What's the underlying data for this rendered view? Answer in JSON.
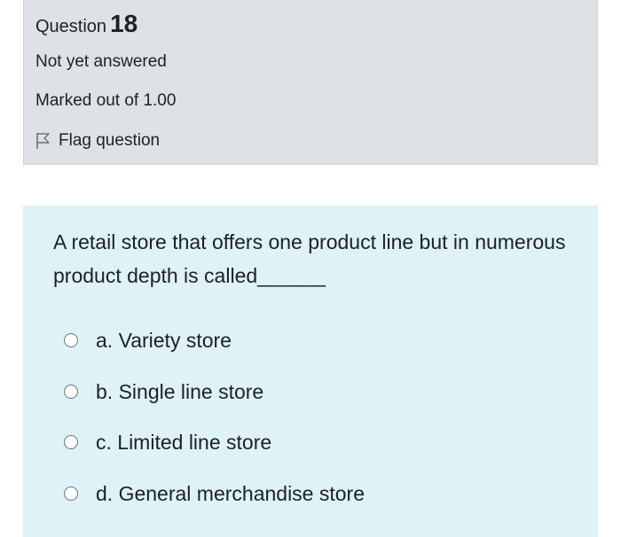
{
  "question_info": {
    "label": "Question",
    "number": "18",
    "status": "Not yet answered",
    "marks": "Marked out of 1.00",
    "flag_label": "Flag question"
  },
  "question": {
    "text": "A retail store that offers one product line but in numerous product depth is called______",
    "answers": [
      {
        "label": "a. Variety store"
      },
      {
        "label": "b. Single line store"
      },
      {
        "label": "c. Limited line store"
      },
      {
        "label": "d. General merchandise store"
      }
    ]
  },
  "colors": {
    "info_background": "#dee2e6",
    "content_background": "#def2f8",
    "text": "#1d2125"
  },
  "icons": {
    "flag": "flag-outline-icon",
    "radio": "radio-unselected-icon"
  }
}
